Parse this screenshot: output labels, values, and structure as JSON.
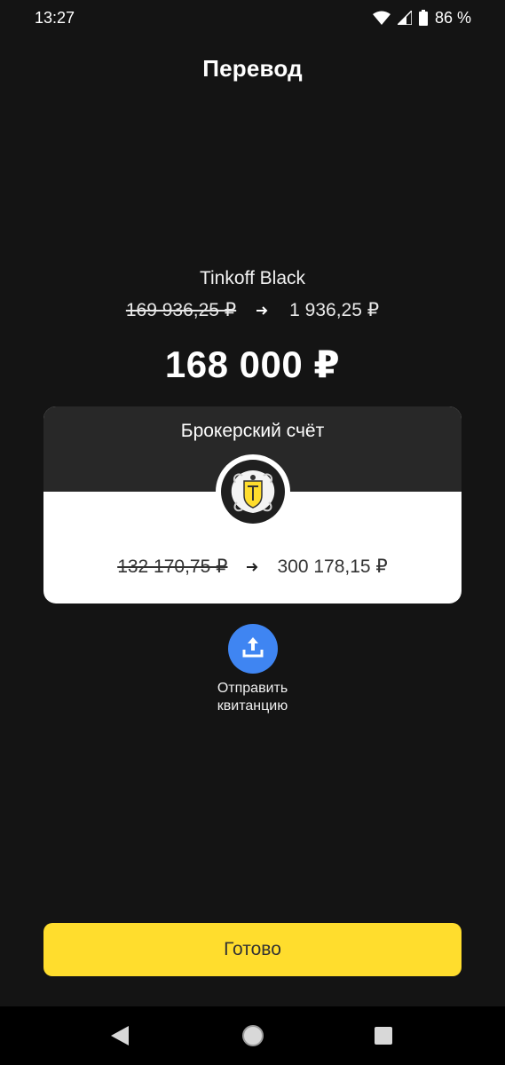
{
  "status_bar": {
    "time": "13:27",
    "battery_percent": "86 %",
    "icons": [
      "wifi-icon",
      "cell-signal-icon",
      "battery-icon"
    ]
  },
  "header": {
    "title": "Перевод"
  },
  "source": {
    "name": "Tinkoff Black",
    "balance_before": "169 936,25 ₽",
    "balance_after": "1 936,25 ₽"
  },
  "transfer": {
    "amount": "168 000 ₽"
  },
  "destination": {
    "name": "Брокерский счёт",
    "logo_icon": "tinkoff-crest-icon",
    "balance_before": "132 170,75 ₽",
    "balance_after": "300 178,15 ₽"
  },
  "actions": {
    "send_receipt_label": "Отправить квитанцию",
    "send_receipt_label_line1": "Отправить",
    "send_receipt_label_line2": "квитанцию",
    "send_receipt_icon": "upload-icon",
    "done_label": "Готово"
  },
  "nav_bar": {
    "icons": [
      "back-icon",
      "home-icon",
      "recents-icon"
    ]
  },
  "colors": {
    "background": "#141414",
    "card_header": "#282828",
    "accent_yellow": "#ffdd2d",
    "accent_blue": "#3f85f2"
  }
}
